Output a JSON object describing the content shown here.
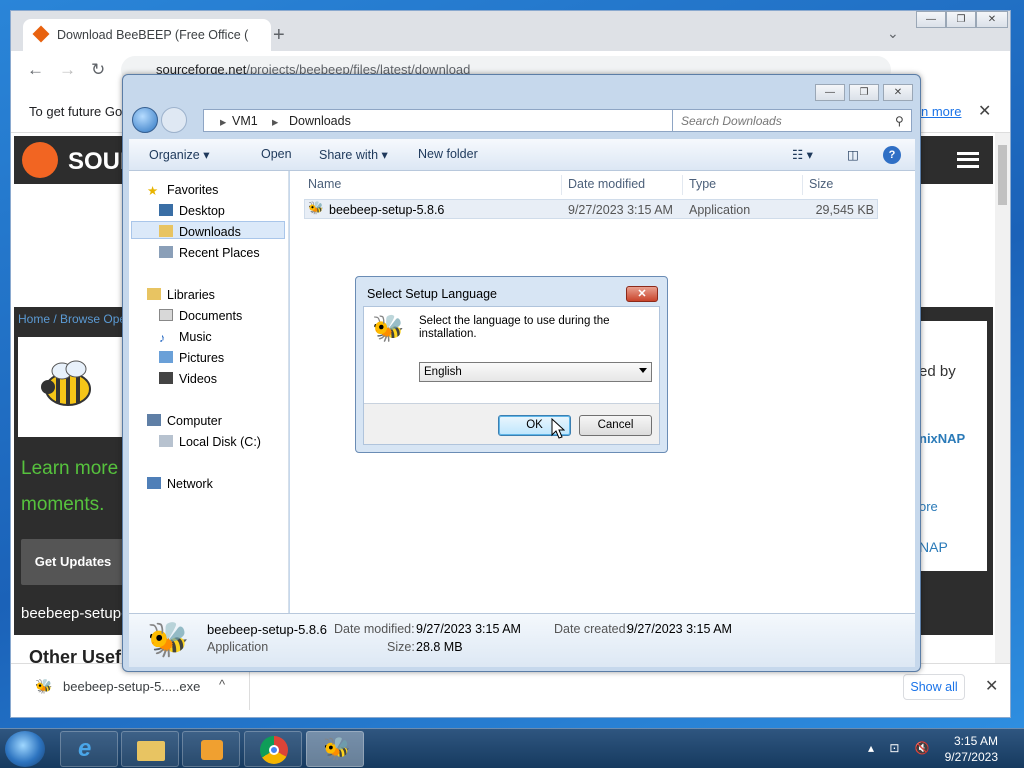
{
  "chrome": {
    "tab_title": "Download BeeBEEP (Free Office (",
    "new_tab": "+",
    "tab_search": "⌄",
    "url_host": "sourceforge.net",
    "url_path": "/projects/beebeep/files/latest/download",
    "back": "←",
    "forward": "→",
    "reload": "↻",
    "minimize": "—",
    "maximize": "❐",
    "close": "✕",
    "infobar_text": "To get future Go",
    "infobar_link": "n more",
    "infobar_close": "✕"
  },
  "page": {
    "logo_text": "SOUF",
    "breadcrumb": "Home / Browse Ope",
    "learn_more": "Learn more moments.",
    "get_updates": "Get Updates",
    "download_name": "beebeep-setup-",
    "other_useful": "Other Usefu",
    "sponsor_a": "ed by",
    "sponsor_b": "nixNAP",
    "sponsor_c": "ore",
    "sponsor_d": "NAP"
  },
  "downloads_bar": {
    "item_name": "beebeep-setup-5.....exe",
    "chevron": "^",
    "show_all": "Show all",
    "close": "✕"
  },
  "explorer": {
    "breadcrumb": [
      "VM1",
      "Downloads"
    ],
    "search_placeholder": "Search Downloads",
    "commands": {
      "organize": "Organize ▾",
      "open": "Open",
      "share_with": "Share with ▾",
      "new_folder": "New folder"
    },
    "nav": {
      "favorites": "Favorites",
      "desktop": "Desktop",
      "downloads": "Downloads",
      "recent_places": "Recent Places",
      "libraries": "Libraries",
      "documents": "Documents",
      "music": "Music",
      "pictures": "Pictures",
      "videos": "Videos",
      "computer": "Computer",
      "local_disk": "Local Disk (C:)",
      "network": "Network"
    },
    "columns": {
      "name": "Name",
      "date_modified": "Date modified",
      "type": "Type",
      "size": "Size"
    },
    "file": {
      "name": "beebeep-setup-5.8.6",
      "date_modified": "9/27/2023 3:15 AM",
      "type": "Application",
      "size": "29,545 KB"
    },
    "status": {
      "name": "beebeep-setup-5.8.6",
      "type": "Application",
      "date_modified_label": "Date modified:",
      "date_modified": "9/27/2023 3:15 AM",
      "date_created_label": "Date created:",
      "date_created": "9/27/2023 3:15 AM",
      "size_label": "Size:",
      "size": "28.8 MB"
    }
  },
  "dialog": {
    "title": "Select Setup Language",
    "close": "✕",
    "message": "Select the language to use during the installation.",
    "language": "English",
    "ok": "OK",
    "cancel": "Cancel"
  },
  "taskbar": {
    "clock_time": "3:15 AM",
    "clock_date": "9/27/2023"
  },
  "colors": {
    "desktop": "#1e6fc0",
    "sourceforge_orange": "#f26522",
    "learn_green": "#56c23d",
    "link_blue": "#1a73e8"
  }
}
